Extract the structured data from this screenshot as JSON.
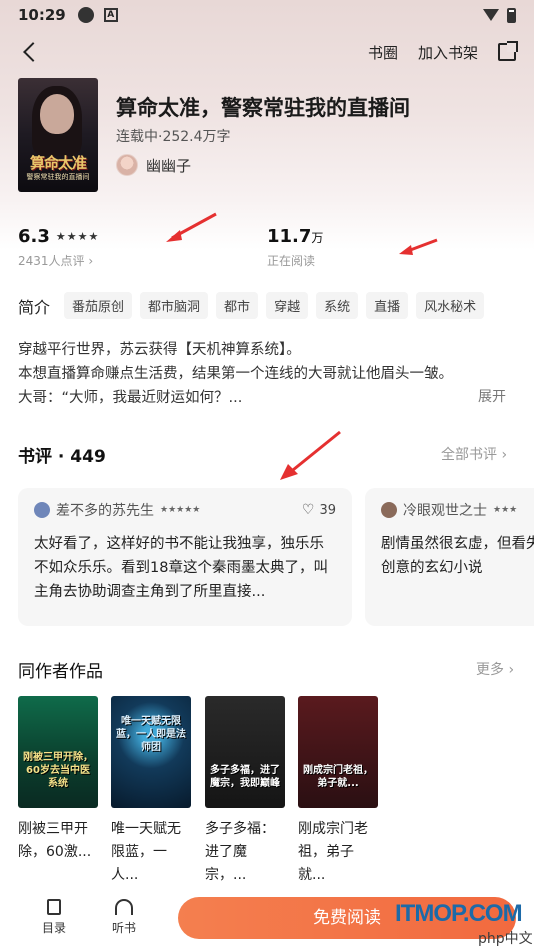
{
  "status_bar": {
    "time": "10:29"
  },
  "nav": {
    "circle_label": "书圈",
    "add_shelf_label": "加入书架"
  },
  "book": {
    "title": "算命太准，警察常驻我的直播间",
    "status": "连载中·252.4万字",
    "author": "幽幽子",
    "cover_title": "算命太准",
    "cover_subtitle": "警察常驻我的直播间"
  },
  "stats": {
    "rating": "6.3",
    "rating_stars": "★★★★",
    "rating_count": "2431人点评 ›",
    "reading_value": "11.7",
    "reading_unit": "万",
    "reading_label": "正在阅读"
  },
  "intro": {
    "label": "简介",
    "tags": [
      "番茄原创",
      "都市脑洞",
      "都市",
      "穿越",
      "系统",
      "直播",
      "风水秘术"
    ],
    "lines": [
      "穿越平行世界，苏云获得【天机神算系统】。",
      "本想直播算命赚点生活费，结果第一个连线的大哥就让他眉头一皱。",
      "大哥：“大师，我最近财运如何？..."
    ],
    "expand_label": "展开"
  },
  "reviews": {
    "title": "书评 · 449",
    "all_label": "全部书评 ›",
    "items": [
      {
        "user": "差不多的苏先生",
        "stars": "★★★★★",
        "likes": "39",
        "text": "太好看了，这样好的书不能让我独享，独乐乐不如众乐乐。看到18章这个秦雨墨太典了，叫主角去协助调查主角到了所里直接..."
      },
      {
        "user": "冷眼观世之士",
        "stars": "★★★",
        "text": "剧情虽然很玄虚，但看失为有创意的玄幻小说"
      }
    ]
  },
  "works": {
    "title": "同作者作品",
    "more_label": "更多 ›",
    "items": [
      {
        "cover_text": "刚被三甲开除，60岁去当中医系统",
        "title": "刚被三甲开除，60激..."
      },
      {
        "cover_text": "唯一天赋无限蓝，一人即是法师团",
        "title": "唯一天赋无限蓝，一人..."
      },
      {
        "cover_text": "多子多福，进了魔宗，我即巅峰",
        "title": "多子多福：进了魔宗，..."
      },
      {
        "cover_text": "刚成宗门老祖，弟子就...",
        "title": "刚成宗门老祖，弟子就..."
      }
    ]
  },
  "bottom": {
    "toc_label": "目录",
    "listen_label": "听书",
    "read_label": "免费阅读"
  },
  "watermark": {
    "brand": "ITMOP.COM",
    "cn": "php中文网"
  }
}
